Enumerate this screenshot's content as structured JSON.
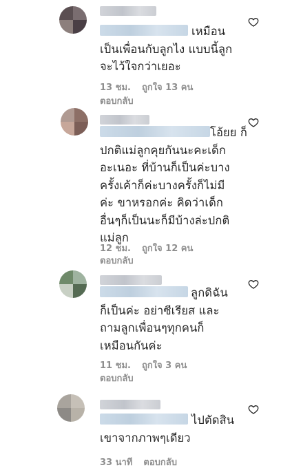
{
  "comments": [
    {
      "text": "เหมือน\nเป็นเพื่อนกับลูกไง แบบนี้ลูก\nจะไว้ใจกว่าเยอะ",
      "time": "13 ชม.",
      "likes": "ถูกใจ 13 คน",
      "reply": "ตอบกลับ",
      "avatar_colors": [
        "#5b4f52",
        "#7a6d70",
        "#8c7f7c",
        "#4a3f45"
      ]
    },
    {
      "text": "โอ้ยย ก็\nปกติแม่ลูกคุยกันนะคะเด็ก\nอะเนอะ ที่บ้านก็เป็นค่ะบาง\nครั้งเค้าก็ค่ะบางครั้งก็ไม่มี\nค่ะ ขาหรอกค่ะ คิดว่าเด็ก\nอื่นๆก็เป็นนะก็มีบ้างล่ะปกติ\nแม่ลูก",
      "time": "12 ชม.",
      "likes": "ถูกใจ 12 คน",
      "reply": "ตอบกลับ",
      "avatar_colors": [
        "#b09a92",
        "#8d6f66",
        "#c7a79a",
        "#7c5e57"
      ]
    },
    {
      "text": "ลูกดิฉัน\nก็เป็นค่ะ อย่าซีเรียส และ\nถามลูกเพื่อนๆทุกคนก็\nเหมือนกันค่ะ",
      "time": "11 ชม.",
      "likes": "ถูกใจ 3 คน",
      "reply": "ตอบกลับ",
      "avatar_colors": [
        "#6f8a6a",
        "#9fb3a0",
        "#c8d0c4",
        "#556b53"
      ]
    },
    {
      "text": "ไปตัดสิน\nเขาจากภาพๆเดียว",
      "time": "33 นาที",
      "likes": "",
      "reply": "ตอบกลับ",
      "avatar_colors": [
        "#a9a49d",
        "#c6c0b7",
        "#8d8a86",
        "#b8b2a8"
      ]
    }
  ],
  "colors": {
    "text": "#262626",
    "meta": "#8e8e8e",
    "heart": "#262626"
  }
}
